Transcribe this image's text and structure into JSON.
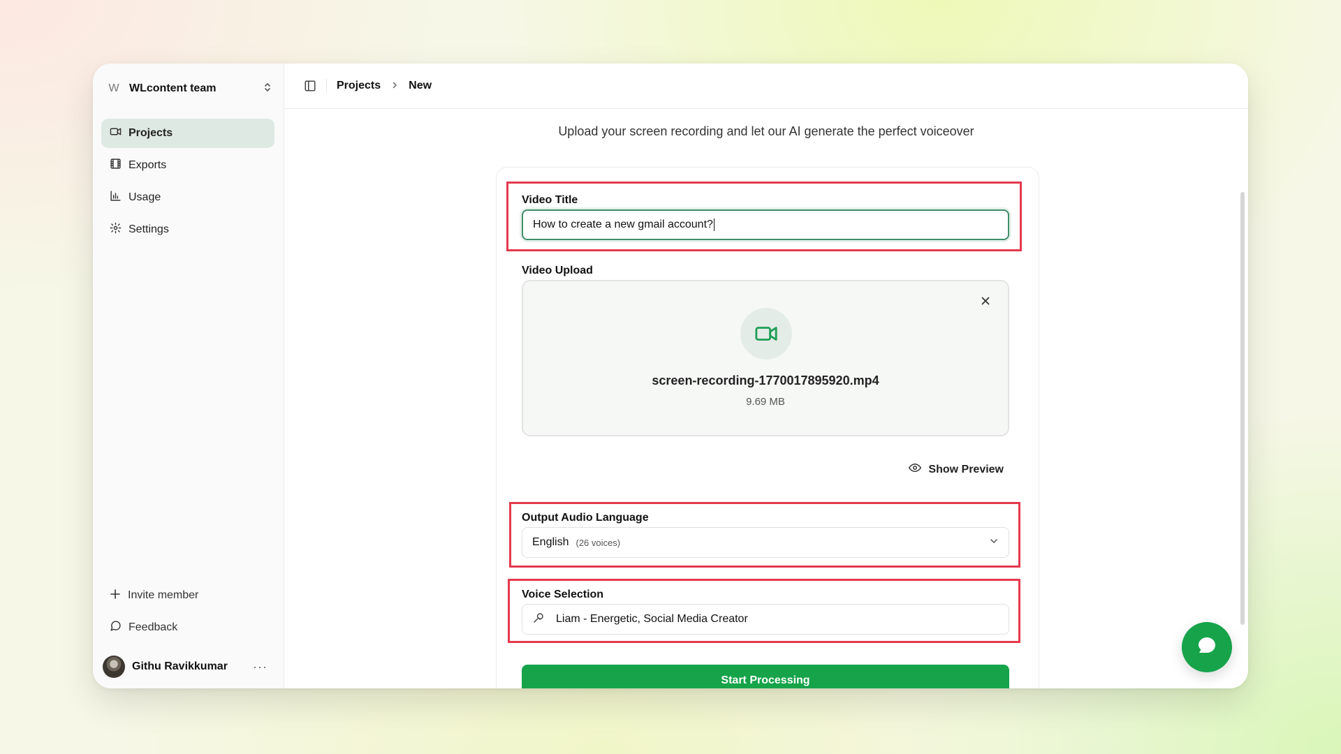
{
  "sidebar": {
    "team_initial": "W",
    "team_name": "WLcontent team",
    "nav": [
      {
        "label": "Projects",
        "icon": "video-icon",
        "active": true
      },
      {
        "label": "Exports",
        "icon": "film-icon"
      },
      {
        "label": "Usage",
        "icon": "bar-chart-icon"
      },
      {
        "label": "Settings",
        "icon": "gear-icon"
      }
    ],
    "invite_label": "Invite member",
    "feedback_label": "Feedback",
    "user_name": "Githu Ravikkumar",
    "more_label": "···"
  },
  "breadcrumb": {
    "parent": "Projects",
    "current": "New"
  },
  "main": {
    "subtitle": "Upload your screen recording and let our AI generate the perfect voiceover"
  },
  "form": {
    "video_title_label": "Video Title",
    "video_title_value": "How to create a new gmail account?",
    "video_upload_label": "Video Upload",
    "file_name": "screen-recording-1770017895920.mp4",
    "file_size": "9.69 MB",
    "show_preview_label": "Show Preview",
    "language_label": "Output Audio Language",
    "language_value": "English",
    "language_voices": "(26 voices)",
    "voice_label": "Voice Selection",
    "voice_value": "Liam - Energetic, Social Media Creator",
    "start_button": "Start Processing"
  },
  "colors": {
    "accent": "#16a34a",
    "highlight": "#e5394d",
    "active_nav": "#dfe9e3"
  }
}
